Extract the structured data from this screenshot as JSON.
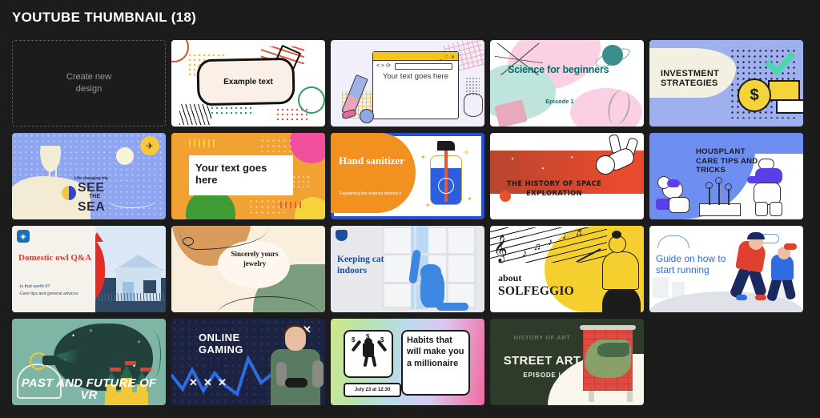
{
  "page": {
    "title": "YOUTUBE THUMBNAIL (18)",
    "background_color": "#1c1c1c",
    "title_color": "#ffffff",
    "item_count": 18
  },
  "create_card": {
    "label": "Create new\ndesign",
    "line1": "Create new",
    "line2": "design"
  },
  "thumbnails": [
    {
      "name": "example-text",
      "text": "Example text",
      "accent": "#faf0e8",
      "background": "#ffffff"
    },
    {
      "name": "browser-your-text",
      "text": "Your text goes here",
      "accent": "#f5c518",
      "background": "#f0effa"
    },
    {
      "name": "science-for-beginners",
      "title": "Science for beginners",
      "subtitle": "Episode 1",
      "accent": "#0d6b6b",
      "background": "#ffffff"
    },
    {
      "name": "investment-strategies",
      "title": "INVESTMENT STRATEGIES",
      "accent": "#f5d33a",
      "background": "#9fb0f0"
    },
    {
      "name": "see-the-sea",
      "kicker": "Life changing trip",
      "line1": "SEE",
      "line2": "THE",
      "line3": "SEA",
      "accent": "#f5c93a",
      "background": "#8ea6f2"
    },
    {
      "name": "orange-your-text",
      "text": "Your text goes here",
      "accent": "#f0509e",
      "background": "#f2a232"
    },
    {
      "name": "hand-sanitizer",
      "title": "Hand sanitizer",
      "subtitle": "Explaining the science behind it",
      "accent": "#f29020",
      "background": "#2b4fd4"
    },
    {
      "name": "history-of-space-exploration",
      "title": "THE HISTORY OF SPACE EXPLORATION",
      "accent": "#e84b2e",
      "background": "#ffffff"
    },
    {
      "name": "housplant-care-tips",
      "title": "HOUSPLANT CARE TIPS AND TRICKS",
      "accent": "#5a3fe8",
      "background": "#6f8ef2"
    },
    {
      "name": "domestic-owl-qa",
      "title": "Domestic owl Q&A",
      "bullet1": "-Is that worth it?",
      "bullet2": "-Care tips and general advices",
      "accent": "#d93a2e",
      "background": "#dce8f5"
    },
    {
      "name": "sincerely-yours-jewelry",
      "title": "Sincerely yours jewelry",
      "accent": "#d99a5e",
      "background": "#faeedd"
    },
    {
      "name": "keeping-cat-indoors",
      "title": "Keeping cat indoors",
      "accent": "#3d87e0",
      "background": "#e6e8ec"
    },
    {
      "name": "about-solfeggio",
      "line1": "about",
      "line2": "SOLFEGGIO",
      "accent": "#f5cf2e",
      "background": "#ffffff"
    },
    {
      "name": "guide-how-to-start-running",
      "title": "Guide on how to start running",
      "accent": "#2e6ce0",
      "background": "#ffffff"
    },
    {
      "name": "past-and-future-of-vr",
      "title": "PAST AND FUTURE OF VR",
      "accent": "#f0c93a",
      "background": "#7fb5a5"
    },
    {
      "name": "online-gaming",
      "line1": "ONLINE",
      "line2": "GAMING",
      "marks": "✕ ✕ ✕",
      "accent": "#2e6ce0",
      "background": "#1c2342"
    },
    {
      "name": "habits-millionaire",
      "title": "Habits that will make you a millionaire",
      "date": "July 23 at 12:30",
      "accent": "#f06a9e",
      "background": "linear-gradient"
    },
    {
      "name": "street-art",
      "kicker": "HISTORY OF ART",
      "title": "STREET ART",
      "episode": "EPISODE I",
      "accent": "#e04a40",
      "background": "#2f3b2a"
    }
  ]
}
